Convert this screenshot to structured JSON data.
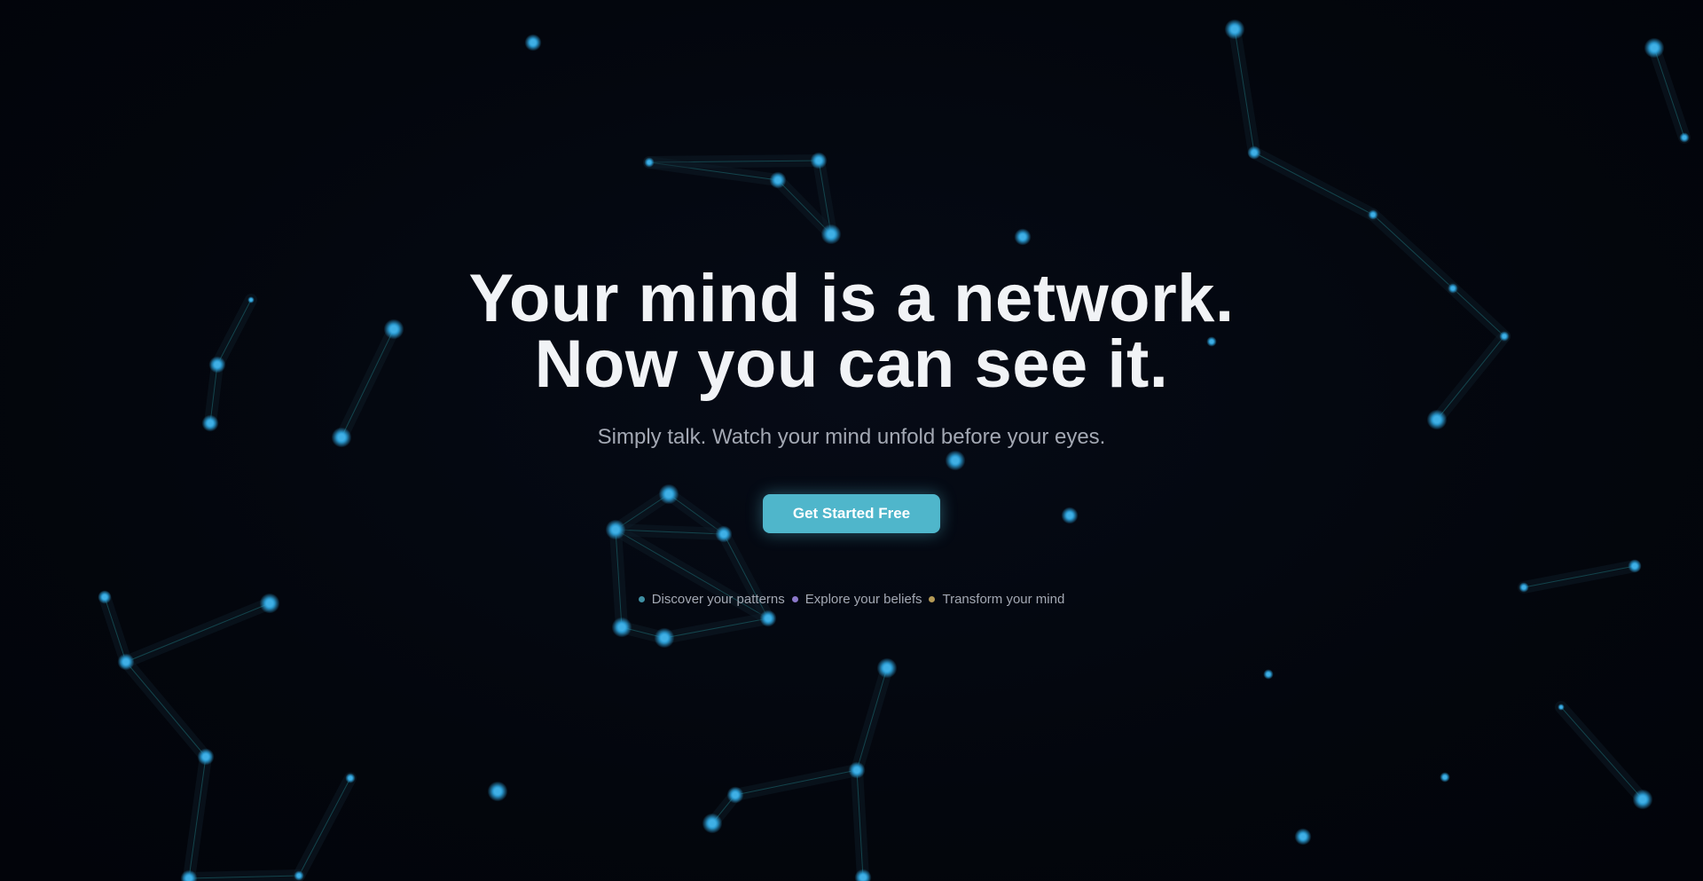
{
  "hero": {
    "headline_line1": "Your mind is a network.",
    "headline_line2": "Now you can see it.",
    "subheadline": "Simply talk. Watch your mind unfold before your eyes.",
    "cta_label": "Get Started Free"
  },
  "features": [
    {
      "label": "Discover your patterns",
      "dot_color": "#3f8fa3"
    },
    {
      "label": "Explore your beliefs",
      "dot_color": "#8b78c9"
    },
    {
      "label": "Transform your mind",
      "dot_color": "#b59a56"
    }
  ],
  "colors": {
    "background": "#03060d",
    "node": "#3fb0e6",
    "edge": "#1e8a8f",
    "accent": "#4fb6cb",
    "headline": "#f1f3f6",
    "muted_text": "#a3a8b3"
  }
}
